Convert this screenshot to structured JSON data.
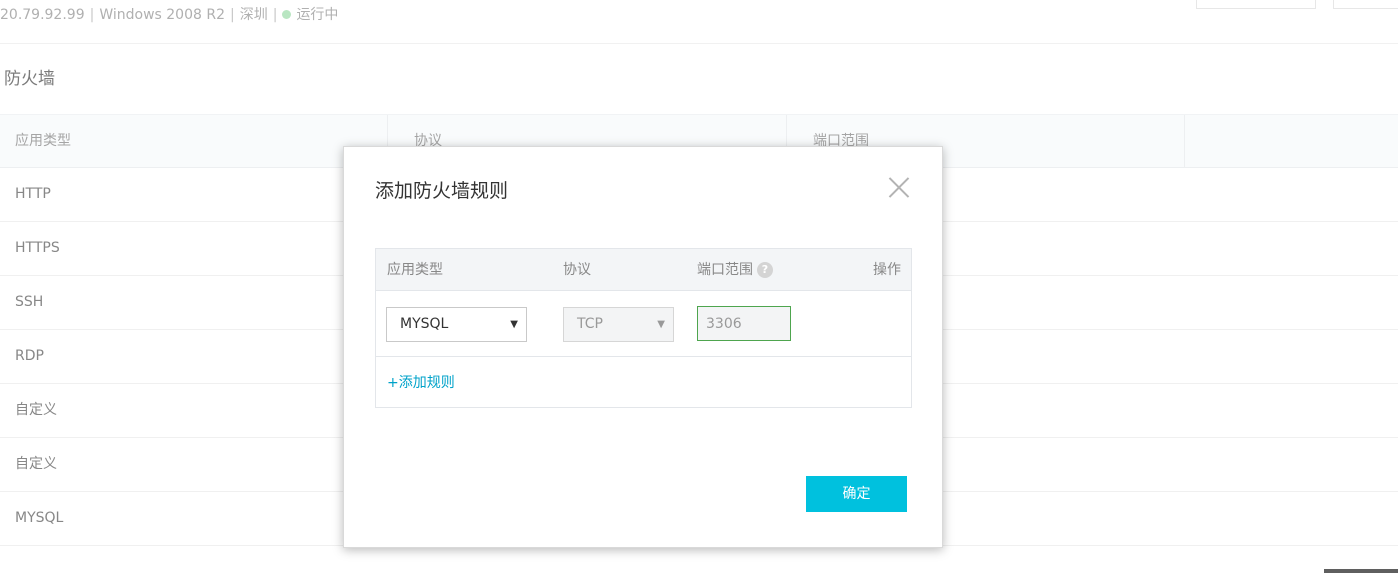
{
  "info_bar": {
    "ip": "20.79.92.99",
    "os": "Windows 2008 R2",
    "region": "深圳",
    "status": "运行中",
    "separator": "|"
  },
  "section": {
    "title": "防火墙"
  },
  "bg_table": {
    "headers": [
      "应用类型",
      "协议",
      "端口范围",
      ""
    ],
    "rows": [
      "HTTP",
      "HTTPS",
      "SSH",
      "RDP",
      "自定义",
      "自定义",
      "MYSQL"
    ]
  },
  "modal": {
    "title": "添加防火墙规则",
    "headers": {
      "type": "应用类型",
      "protocol": "协议",
      "port": "端口范围",
      "action": "操作"
    },
    "help_icon_glyph": "?",
    "row": {
      "type_value": "MYSQL",
      "protocol_value": "TCP",
      "port_value": "3306"
    },
    "dropdown_arrow": "▼",
    "add_rule_label": "+添加规则",
    "confirm_label": "确定"
  },
  "colors": {
    "accent": "#00c1de",
    "link": "#00a2c9",
    "status_running": "#a6dfb1",
    "input_focus_border": "#4ea54e"
  }
}
